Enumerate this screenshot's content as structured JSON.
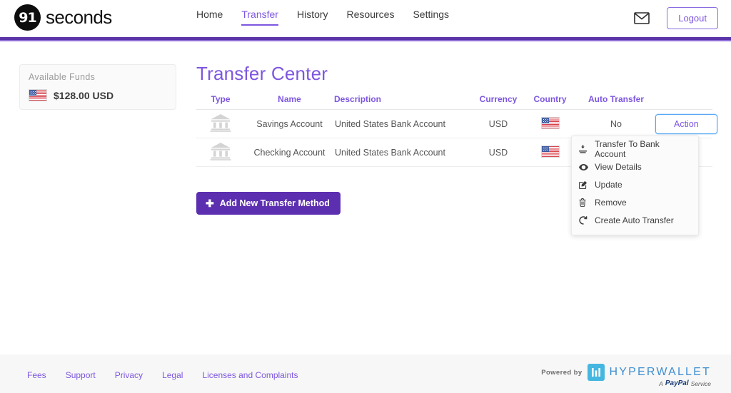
{
  "header": {
    "logo": {
      "mark": "91",
      "text": "seconds"
    },
    "nav": [
      {
        "label": "Home",
        "active": false
      },
      {
        "label": "Transfer",
        "active": true
      },
      {
        "label": "History",
        "active": false
      },
      {
        "label": "Resources",
        "active": false
      },
      {
        "label": "Settings",
        "active": false
      }
    ],
    "mail_icon": "envelope-icon",
    "logout_label": "Logout",
    "accent_color": "#7d56e0",
    "bar_color": "#5a34a8"
  },
  "sidebar": {
    "funds_title": "Available Funds",
    "funds_amount": "$128.00 USD",
    "funds_flag": "us-flag-icon"
  },
  "main": {
    "title": "Transfer Center",
    "columns": [
      "Type",
      "Name",
      "Description",
      "Currency",
      "Country",
      "Auto Transfer",
      ""
    ],
    "rows": [
      {
        "type_icon": "bank-icon",
        "name": "Savings Account",
        "description": "United States Bank Account",
        "currency": "USD",
        "country_icon": "us-flag-icon",
        "auto_transfer": "No",
        "action_label": "Action"
      },
      {
        "type_icon": "bank-icon",
        "name": "Checking Account",
        "description": "United States Bank Account",
        "currency": "USD",
        "country_icon": "us-flag-icon",
        "auto_transfer": "",
        "action_label": ""
      }
    ],
    "add_button": {
      "icon": "plus-icon",
      "label": "Add New Transfer Method"
    }
  },
  "dropdown": {
    "items": [
      {
        "icon": "download-icon",
        "label": "Transfer To Bank Account"
      },
      {
        "icon": "eye-icon",
        "label": "View Details"
      },
      {
        "icon": "edit-icon",
        "label": "Update"
      },
      {
        "icon": "trash-icon",
        "label": "Remove"
      },
      {
        "icon": "refresh-icon",
        "label": "Create Auto Transfer"
      }
    ]
  },
  "footer": {
    "links": [
      "Fees",
      "Support",
      "Privacy",
      "Legal",
      "Licenses and Complaints"
    ],
    "powered_by": "Powered by",
    "brand": "HYPERWALLET",
    "sub_prefix": "A",
    "sub_brand": "PayPal",
    "sub_suffix": "Service"
  }
}
